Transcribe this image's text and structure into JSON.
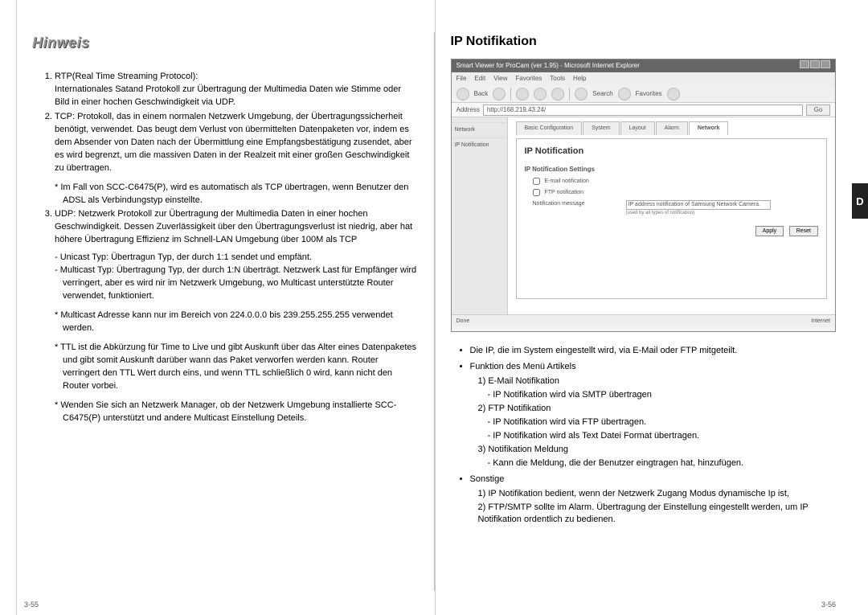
{
  "left": {
    "heading": "Hinweis",
    "item1_head": "RTP(Real Time Streaming Protocol):",
    "item1_body": "Internationales Satand Protokoll zur Übertragung der Multimedia Daten wie Stimme oder Bild in einer hochen Geschwindigkeit via UDP.",
    "item2": "TCP: Protokoll, das in einem normalen Netzwerk Umgebung, der Übertragungssicherheit benötigt,  verwendet. Das beugt dem Verlust von übermittelten Datenpaketen vor, indem es dem Absender von Daten nach der Übermittlung eine Empfangsbestätigung zusendet, aber es wird begrenzt, um die massiven Daten in der Realzeit mit einer großen Geschwindigkeit zu übertragen.",
    "item2_star": "* Im Fall von SCC-C6475(P), wird es automatisch als TCP übertragen, wenn Benutzer den ADSL als Verbindungstyp einstellte.",
    "item3": "UDP: Netzwerk Protokoll zur Übertragung der Multimedia Daten in einer hochen Geschwindigkeit. Dessen Zuverlässigkeit über den Übertragungsverlust ist niedrig, aber hat höhere Übertragung Effizienz im Schnell-LAN Umgebung über 100M als TCP",
    "item3_d1": "- Unicast Typ: Übertragun Typ, der durch 1:1 sendet und empfänt.",
    "item3_d2": "- Multicast Typ: Übertragung Typ, der durch 1:N überträgt. Netzwerk Last für Empfänger wird verringert, aber es wird nir im Netzwerk Umgebung, wo Multicast unterstützte Router verwendet, funktioniert.",
    "item3_s1": "* Multicast Adresse kann nur im Bereich von 224.0.0.0 bis 239.255.255.255 verwendet werden.",
    "item3_s2": "* TTL ist die Abkürzung für Time to Live und gibt Auskunft über das Alter eines Datenpaketes und gibt somit Auskunft darüber wann das Paket verworfen werden kann. Router verringert den TTL Wert durch eins, und wenn TTL schließlich 0 wird, kann nicht den Router vorbei.",
    "item3_s3": "* Wenden Sie sich an Netzwerk Manager, ob der Netzwerk Umgebung installierte SCC-C6475(P) unterstützt und andere Multicast Einstellung Deteils.",
    "page": "3-55"
  },
  "right": {
    "heading": "IP Notifikation",
    "screenshot": {
      "title": "Smart Viewer for ProCam (ver 1.95) - Microsoft Internet Explorer",
      "menu": [
        "File",
        "Edit",
        "View",
        "Favorites",
        "Tools",
        "Help"
      ],
      "toolbar_back": "Back",
      "toolbar_search": "Search",
      "toolbar_fav": "Favorites",
      "addr_label": "Address",
      "addr_url": "http://168.219.43.24/",
      "go": "Go",
      "side1": "Network",
      "side2": "IP Notification",
      "tabs": [
        "Basic Configuration",
        "System",
        "Layout",
        "Alarm",
        "Network"
      ],
      "active_tab_index": 4,
      "panel_title": "IP Notification",
      "fs_label": "IP Notification Settings",
      "cb1": "E-mail notification",
      "cb2": "FTP notification",
      "row_label": "Notification message",
      "row_value": "IP address notification of Samsung Network Camera.",
      "row_hint": "(used by all types of notification)",
      "apply": "Apply",
      "reset": "Reset",
      "status_left": "Done",
      "status_right": "Internet"
    },
    "b1": "Die IP, die im System eingestellt wird, via E-Mail oder FTP mitgeteilt.",
    "b2": "Funktion des Menü Artikels",
    "b2_1": "1) E-Mail Notifikation",
    "b2_1d": "- IP Notifikation wird via SMTP übertragen",
    "b2_2": "2) FTP Notifikation",
    "b2_2d1": "- IP Notifikation wird via FTP übertragen.",
    "b2_2d2": "- IP Notifikation wird als Text Datei Format übertragen.",
    "b2_3": "3) Notifikation Meldung",
    "b2_3d": "- Kann die Meldung, die der Benutzer eingtragen hat, hinzufügen.",
    "b3": "Sonstige",
    "b3_1": "1) IP Notifikation bedient, wenn der Netzwerk Zugang Modus dynamische Ip ist,",
    "b3_2": "2) FTP/SMTP sollte im Alarm. Übertragung der Einstellung eingestellt werden, um IP Notifikation ordentlich zu bedienen.",
    "page": "3-56",
    "side_letter": "D"
  }
}
